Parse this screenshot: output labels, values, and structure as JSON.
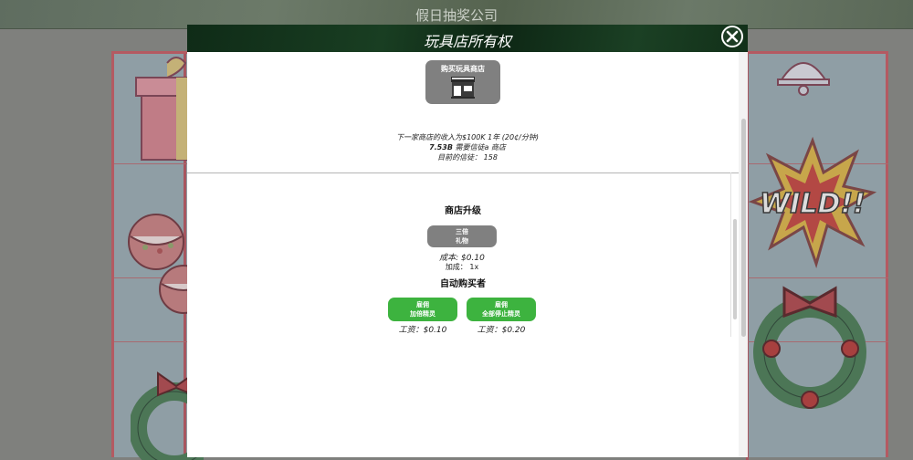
{
  "game": {
    "title": "假日抽奖公司"
  },
  "modal": {
    "title": "玩具店所有权",
    "buy_button": {
      "label": "购买玩具商店",
      "icon": "shop-icon"
    },
    "info": {
      "line1": "下一家商店的收入为$100K 1年 (20¢/分钟)",
      "line2_bold": "7.53B",
      "line2_rest": " 需要信徒a 商店",
      "line3": "目前的信徒： 158"
    },
    "upgrades": {
      "title": "商店升级",
      "button_line1": "三倍",
      "button_line2": "礼物",
      "cost": "成本: $0.10",
      "bonus": "加成： 1x"
    },
    "auto_buyers": {
      "title": "自动购买者",
      "buyers": [
        {
          "line1": "雇佣",
          "line2": "加倍精灵",
          "wage": "工资：$0.10"
        },
        {
          "line1": "雇佣",
          "line2": "全部停止精灵",
          "wage": "工资：$0.20"
        }
      ]
    }
  },
  "colors": {
    "header": "#153520",
    "green_button": "#3db33f",
    "gray_button": "#808080",
    "board_border": "#b45a62"
  }
}
